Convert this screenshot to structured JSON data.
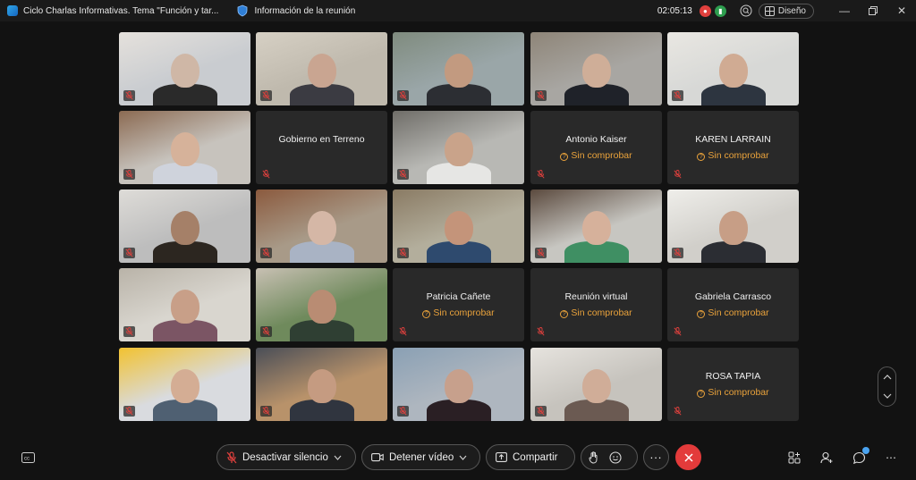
{
  "titlebar": {
    "meeting_title": "Ciclo Charlas Informativas. Tema \"Función y tar...",
    "info_label": "Información de la reunión",
    "time": "02:05:13",
    "layout_label": "Diseño"
  },
  "tiles": [
    {
      "type": "video",
      "label": "participant-video-1"
    },
    {
      "type": "video",
      "label": "participant-video-2"
    },
    {
      "type": "video",
      "label": "participant-video-3"
    },
    {
      "type": "video",
      "label": "participant-video-4"
    },
    {
      "type": "video",
      "label": "participant-video-5"
    },
    {
      "type": "video",
      "label": "participant-video-6"
    },
    {
      "type": "name",
      "name": "Gobierno en Terreno",
      "status": ""
    },
    {
      "type": "video",
      "label": "participant-video-8"
    },
    {
      "type": "name",
      "name": "Antonio Kaiser",
      "status": "Sin comprobar"
    },
    {
      "type": "name",
      "name": "KAREN LARRAIN",
      "status": "Sin comprobar"
    },
    {
      "type": "video",
      "label": "participant-video-11"
    },
    {
      "type": "video",
      "label": "participant-video-12"
    },
    {
      "type": "video",
      "label": "participant-video-13"
    },
    {
      "type": "video",
      "label": "participant-video-14"
    },
    {
      "type": "video",
      "label": "participant-video-15"
    },
    {
      "type": "video",
      "label": "participant-video-16"
    },
    {
      "type": "video",
      "label": "participant-video-17"
    },
    {
      "type": "name",
      "name": "Patricia Cañete",
      "status": "Sin comprobar"
    },
    {
      "type": "name",
      "name": "Reunión virtual",
      "status": "Sin comprobar"
    },
    {
      "type": "name",
      "name": "Gabriela Carrasco",
      "status": "Sin comprobar"
    },
    {
      "type": "video",
      "label": "participant-video-21"
    },
    {
      "type": "video",
      "label": "participant-video-22"
    },
    {
      "type": "video",
      "label": "participant-video-23"
    },
    {
      "type": "video",
      "label": "participant-video-24"
    },
    {
      "type": "name",
      "name": "ROSA TAPIA",
      "status": "Sin comprobar"
    }
  ],
  "toolbar": {
    "mute_label": "Desactivar silencio",
    "video_label": "Detener vídeo",
    "share_label": "Compartir"
  },
  "colors": {
    "background": "#121212",
    "tile": "#2b2b2b",
    "unverified": "#e9a23b",
    "end_call": "#e33b3b",
    "notification": "#4aa3f0"
  }
}
